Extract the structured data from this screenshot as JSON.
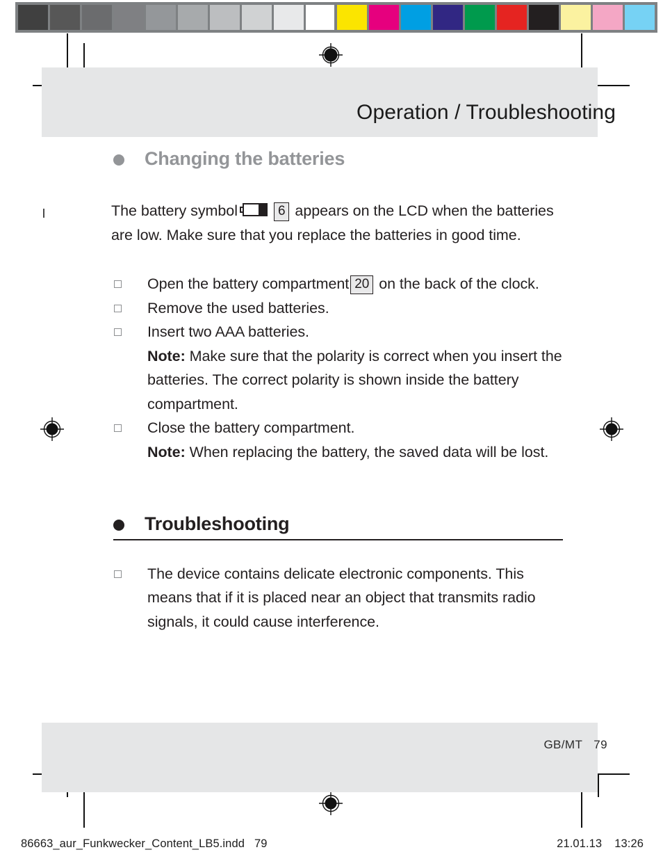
{
  "prepress": {
    "gray_bar": {
      "name": "grayscale-calibration-bar",
      "swatches": [
        "#404040",
        "#575757",
        "#6b6c6e",
        "#7f8083",
        "#94979a",
        "#a7aaac",
        "#bcbec0",
        "#d0d2d3",
        "#e8e9ea",
        "#ffffff"
      ]
    },
    "chroma_bar": {
      "name": "color-calibration-bar",
      "swatches": [
        "#fbe500",
        "#e6007e",
        "#009fe3",
        "#312783",
        "#009a4d",
        "#e52421",
        "#231f20",
        "#fbf2a0",
        "#f4a7c5",
        "#76d2f4"
      ]
    }
  },
  "header": {
    "title": "Operation / Troubleshooting"
  },
  "sections": [
    {
      "id": "changing-the-batteries",
      "heading": "Changing the batteries",
      "heading_style": "gray",
      "intro": {
        "before_battery": "The battery symbol",
        "battery_icon": "battery-low-icon",
        "ref_number": "6",
        "after_ref": "appears on the LCD when the batteries are low. Make sure that you replace the batteries in good time."
      },
      "items": [
        {
          "bullet": "square-bullet",
          "text_before_ref": "Open the battery compartment",
          "ref_number": "20",
          "text_after_ref": "on the back of the clock."
        },
        {
          "bullet": "square-bullet",
          "text": "Remove the used batteries."
        },
        {
          "bullet": "square-bullet",
          "text": "Insert two AAA batteries.",
          "note_label": "Note:",
          "note_text": "Make sure that the polarity is correct when you insert the batteries. The correct polarity is shown inside the battery compartment."
        },
        {
          "bullet": "square-bullet",
          "text": "Close the battery compartment.",
          "note_label": "Note:",
          "note_text": "When replacing the battery, the saved data will be lost."
        }
      ]
    },
    {
      "id": "troubleshooting",
      "heading": "Troubleshooting",
      "heading_style": "black-underlined",
      "items": [
        {
          "bullet": "square-bullet",
          "text": "The device contains delicate electronic components. This means that if it is placed near an object that transmits radio signals, it could cause interference."
        }
      ]
    }
  ],
  "footer": {
    "locale": "GB/MT",
    "page_number": "79"
  },
  "print_meta": {
    "filename": "86663_aur_Funkwecker_Content_LB5.indd",
    "page_number": "79",
    "date": "21.01.13",
    "time": "13:26"
  }
}
